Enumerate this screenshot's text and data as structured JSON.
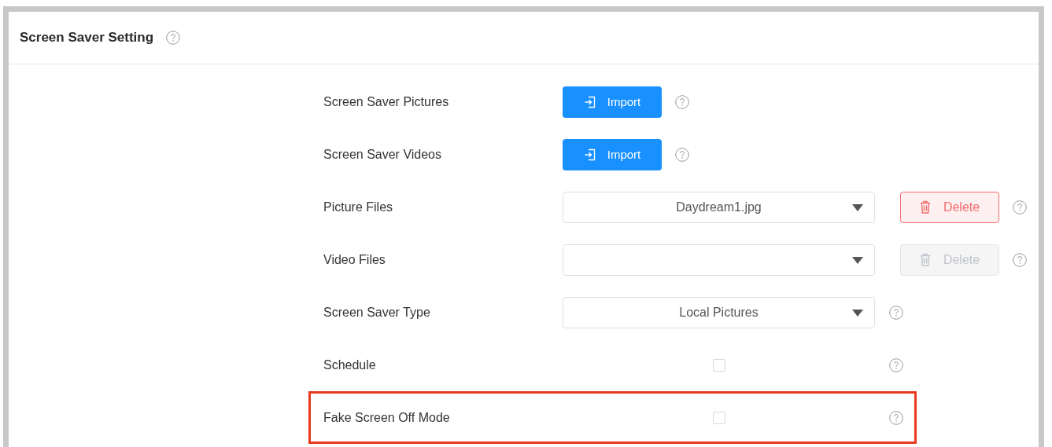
{
  "header": {
    "title": "Screen Saver Setting"
  },
  "rows": [
    {
      "kind": "import",
      "label": "Screen Saver Pictures",
      "button": "Import",
      "highlighted": false
    },
    {
      "kind": "import",
      "label": "Screen Saver Videos",
      "button": "Import",
      "highlighted": false
    },
    {
      "kind": "file",
      "label": "Picture Files",
      "value": "Daydream1.jpg",
      "button": "Delete",
      "disabled": false,
      "highlighted": false
    },
    {
      "kind": "file",
      "label": "Video Files",
      "button": "Delete",
      "disabled": true,
      "highlighted": false
    },
    {
      "kind": "select",
      "label": "Screen Saver Type",
      "value": "Local Pictures",
      "highlighted": false
    },
    {
      "kind": "checkbox",
      "label": "Schedule",
      "checked": false,
      "highlighted": false
    },
    {
      "kind": "checkbox",
      "label": "Fake Screen Off Mode",
      "checked": false,
      "highlighted": true
    }
  ]
}
